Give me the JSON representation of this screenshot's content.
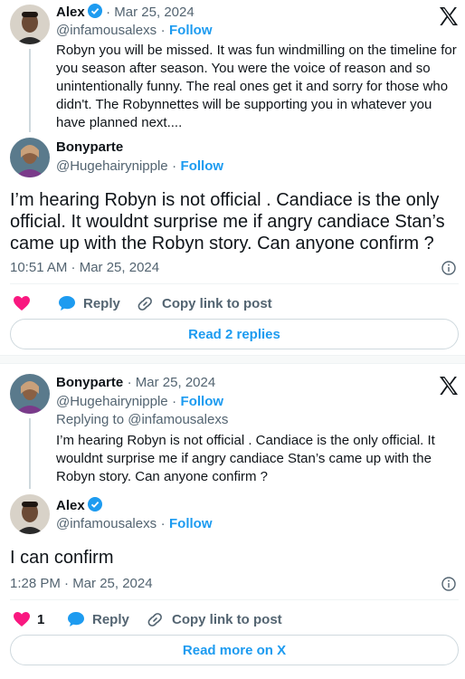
{
  "tweet1": {
    "parent": {
      "name": "Alex",
      "date": "· Mar 25, 2024",
      "handle": "@infamousalexs",
      "separator": "·",
      "follow": "Follow",
      "text_lines": [
        "Robyn you will be missed. It was fun windmilling on the timeline for",
        "you season after season. You were the voice of reason and so",
        "unintentionally funny. The real ones get it and sorry for those who",
        "didn't. The Robynnettes will be supporting you in whatever you",
        "have planned next...."
      ]
    },
    "main": {
      "name": "Bonyparte",
      "handle": "@Hugehairynipple",
      "separator": "·",
      "follow": "Follow",
      "text_lines": [
        "I’m hearing Robyn is not official . Candiace is the only",
        "official.  It wouldnt surprise me if angry candiace Stan’s",
        "came up with the Robyn story.  Can anyone confirm ?"
      ],
      "timestamp": "10:51 AM · Mar 25, 2024"
    },
    "actions": {
      "reply": "Reply",
      "copy": "Copy link to post"
    },
    "footer_button": "Read 2 replies"
  },
  "tweet2": {
    "parent": {
      "name": "Bonyparte",
      "date": "· Mar 25, 2024",
      "handle": "@Hugehairynipple",
      "separator": "·",
      "follow": "Follow",
      "replying_to": "Replying to @infamousalexs",
      "text_lines": [
        "I’m hearing Robyn is not official . Candiace is the only official.  It",
        "wouldnt surprise me if angry candiace Stan’s came up with the",
        "Robyn story.  Can anyone confirm ?"
      ]
    },
    "main": {
      "name": "Alex",
      "handle": "@infamousalexs",
      "separator": "·",
      "follow": "Follow",
      "text": "I can confirm",
      "timestamp": "1:28 PM · Mar 25, 2024"
    },
    "actions": {
      "like_count": "1",
      "reply": "Reply",
      "copy": "Copy link to post"
    },
    "footer_button": "Read more on X"
  },
  "colors": {
    "accent": "#1d9bf0",
    "like": "#f91880",
    "muted": "#536471",
    "text": "#0f1419"
  },
  "icons": [
    "x-logo-icon",
    "verified-badge-icon",
    "heart-icon",
    "reply-bubble-icon",
    "link-icon",
    "info-icon"
  ]
}
